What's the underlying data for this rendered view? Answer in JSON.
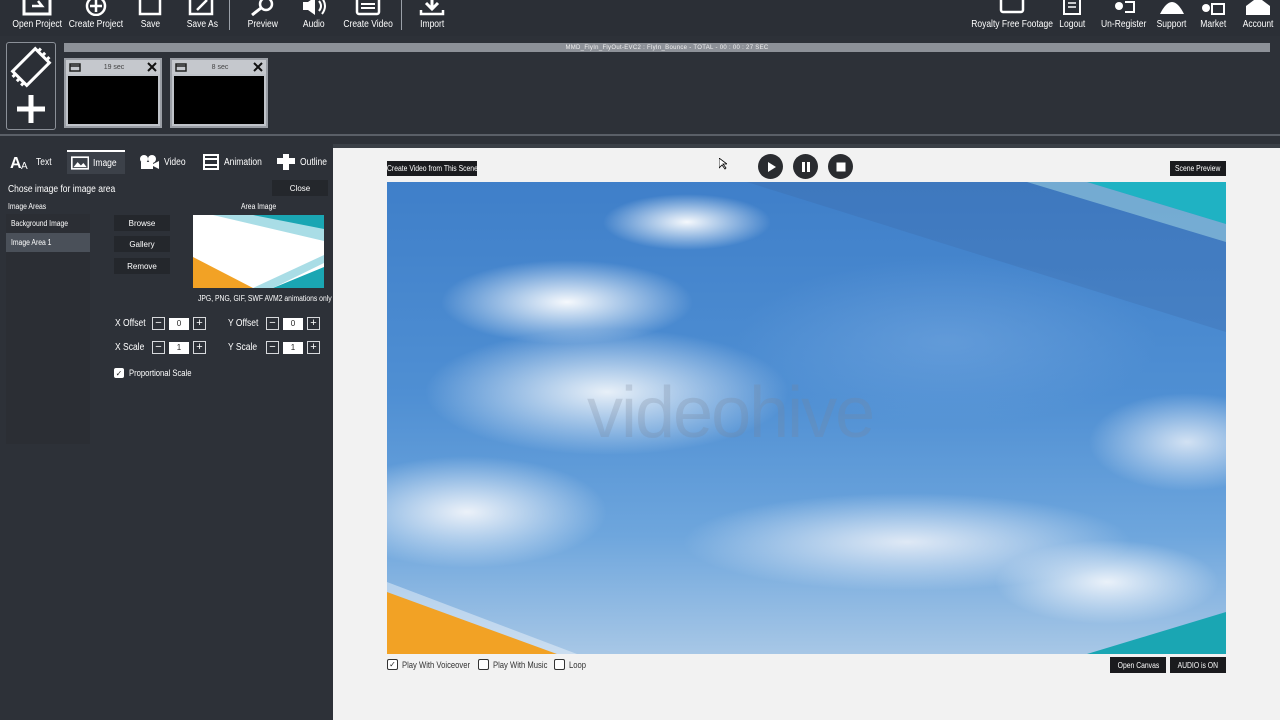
{
  "toolbar": {
    "left": [
      {
        "label": "Open Project",
        "icon": "open-project-icon"
      },
      {
        "label": "Create Project",
        "icon": "create-project-icon"
      },
      {
        "label": "Save",
        "icon": "save-icon"
      },
      {
        "label": "Save As",
        "icon": "save-as-icon"
      },
      {
        "label": "Preview",
        "icon": "preview-icon"
      },
      {
        "label": "Audio",
        "icon": "audio-icon"
      },
      {
        "label": "Create Video",
        "icon": "create-video-icon"
      },
      {
        "label": "Import",
        "icon": "import-icon"
      }
    ],
    "right": [
      {
        "label": "Royalty Free Footage",
        "icon": "footage-icon"
      },
      {
        "label": "Logout",
        "icon": "logout-icon"
      },
      {
        "label": "Un-Register",
        "icon": "unregister-icon"
      },
      {
        "label": "Support",
        "icon": "support-icon"
      },
      {
        "label": "Market",
        "icon": "market-icon"
      },
      {
        "label": "Account",
        "icon": "account-icon"
      }
    ]
  },
  "timeline": {
    "title": "MMD_FlyIn_FlyOut-EVC2 : FlyIn_Bounce  -  TOTAL - 00 : 00 : 27 SEC"
  },
  "scenes": [
    {
      "duration": "19 sec"
    },
    {
      "duration": "8 sec"
    }
  ],
  "tabs": [
    {
      "label": "Text",
      "icon": "text-icon"
    },
    {
      "label": "Image",
      "icon": "image-icon",
      "active": true
    },
    {
      "label": "Video",
      "icon": "video-icon"
    },
    {
      "label": "Animation",
      "icon": "animation-icon"
    },
    {
      "label": "Outline",
      "icon": "outline-icon"
    }
  ],
  "image_panel": {
    "heading": "Chose image for image area",
    "close_label": "Close",
    "areas_heading": "Image Areas",
    "areas": [
      "Background Image",
      "Image Area 1"
    ],
    "selected_area": "Image Area 1",
    "browse_label": "Browse",
    "gallery_label": "Gallery",
    "remove_label": "Remove",
    "area_image_label": "Area Image",
    "formats_note": "JPG, PNG, GIF, SWF AVM2 animations only",
    "x_offset_label": "X Offset",
    "x_offset_value": "0",
    "y_offset_label": "Y Offset",
    "y_offset_value": "0",
    "x_scale_label": "X Scale",
    "x_scale_value": "1",
    "y_scale_label": "Y Scale",
    "y_scale_value": "1",
    "proportional_label": "Proportional Scale",
    "proportional_checked": true
  },
  "canvas": {
    "create_video_label": "Create Video from This Scene",
    "scene_preview_label": "Scene Preview",
    "watermark": "videohive",
    "play_voiceover_label": "Play With Voiceover",
    "play_voiceover_checked": true,
    "play_music_label": "Play With Music",
    "play_music_checked": false,
    "loop_label": "Loop",
    "loop_checked": false,
    "open_canvas_label": "Open Canvas",
    "audio_label": "AUDIO is ON"
  },
  "colors": {
    "orange": "#f2a225",
    "teal": "#1aa6b3",
    "light_blue": "#a9dde6"
  }
}
